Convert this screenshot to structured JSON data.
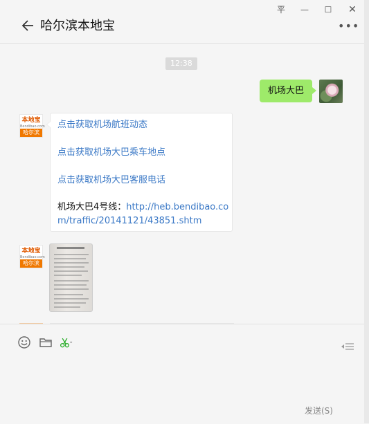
{
  "window": {
    "title": "哈尔滨本地宝",
    "pin_glyph": "平",
    "controls": {
      "minimize": "—",
      "maximize": "☐",
      "close": "✕"
    },
    "more": "•••"
  },
  "chat": {
    "timestamp": "12:38",
    "outgoing": {
      "text": "机场大巴"
    },
    "bot_avatar": {
      "brand": "本地宝",
      "site": "Bendibao.com",
      "city": "哈尔滨"
    },
    "card": {
      "links": [
        "点击获取机场航班动态",
        "点击获取机场大巴乘车地点",
        "点击获取机场大巴客服电话"
      ],
      "route_label": "机场大巴4号线：",
      "route_url": "http://heb.bendibao.com/traffic/20141121/43851.shtm"
    }
  },
  "input": {
    "send_label": "发送(S)"
  },
  "colors": {
    "bubble_green": "#9eea6a",
    "link_blue": "#3a78c6",
    "brand_orange": "#f07800"
  }
}
